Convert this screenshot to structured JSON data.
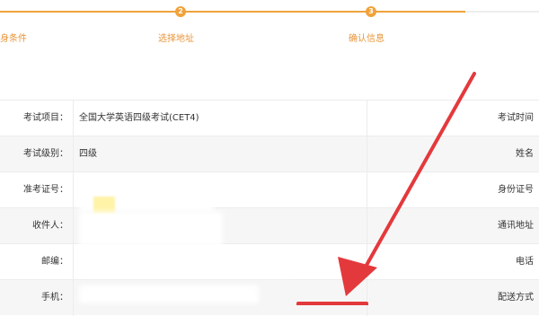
{
  "stepper": {
    "steps": [
      {
        "number": "",
        "label": "身条件"
      },
      {
        "number": "2",
        "label": "选择地址"
      },
      {
        "number": "3",
        "label": "确认信息"
      }
    ]
  },
  "info": {
    "rows": [
      {
        "label": "考试项目：",
        "value": "全国大学英语四级考试(CET4)",
        "right_label": "考试时间"
      },
      {
        "label": "考试级别：",
        "value": "四级",
        "right_label": "姓名"
      },
      {
        "label": "准考证号：",
        "value": "",
        "right_label": "身份证号"
      },
      {
        "label": "收件人：",
        "value": "",
        "right_label": "通讯地址"
      },
      {
        "label": "邮编：",
        "value": "",
        "right_label": "电话"
      },
      {
        "label": "手机：",
        "value": "",
        "right_label": "配送方式"
      }
    ]
  },
  "colors": {
    "accent": "#f0a23a",
    "arrow": "#e4393c"
  }
}
